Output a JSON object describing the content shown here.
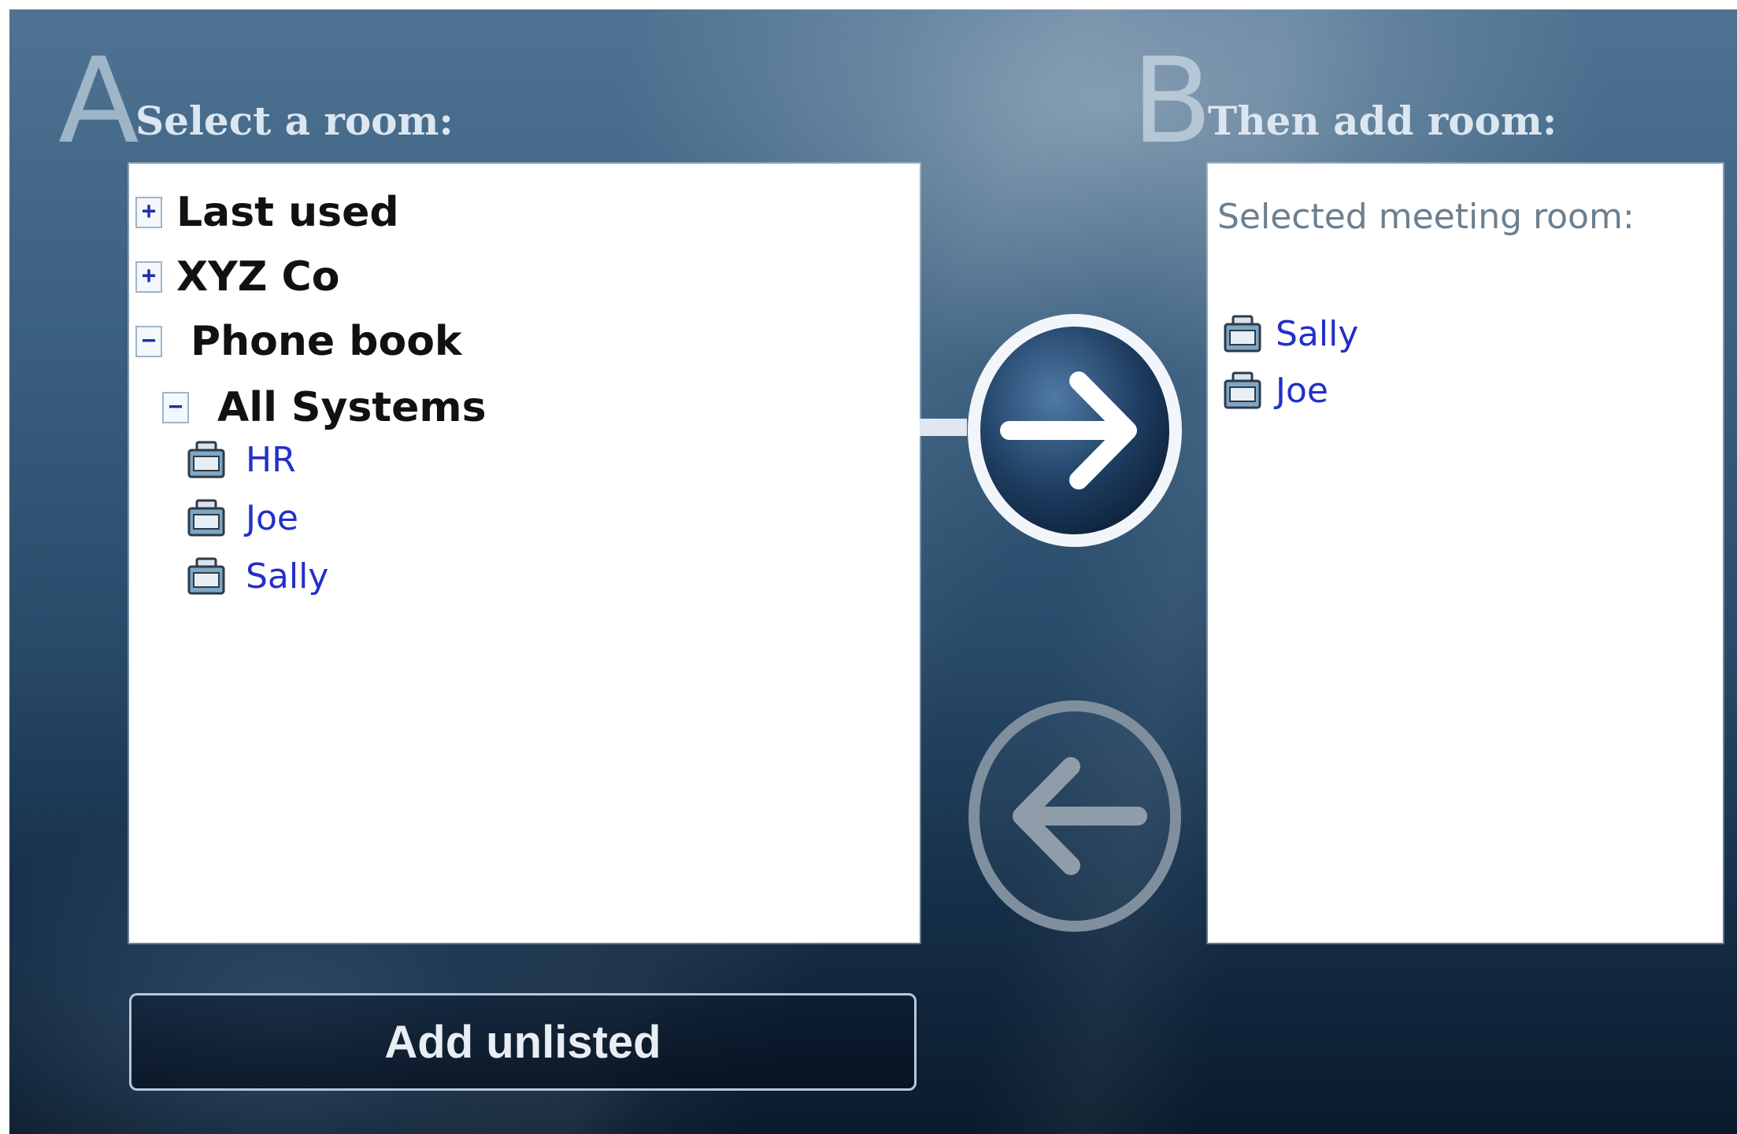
{
  "section_a": {
    "letter": "A",
    "title": "Select a room:"
  },
  "section_b": {
    "letter": "B",
    "title": "Then add room:"
  },
  "tree": {
    "nodes": [
      {
        "toggle": "+",
        "label": "Last used"
      },
      {
        "toggle": "+",
        "label": "XYZ Co"
      },
      {
        "toggle": "−",
        "label": "Phone book"
      },
      {
        "toggle": "−",
        "label": "All Systems"
      }
    ],
    "rooms": [
      "HR",
      "Joe",
      "Sally"
    ]
  },
  "selected": {
    "title": "Selected meeting room:",
    "rooms": [
      "Sally",
      "Joe"
    ]
  },
  "buttons": {
    "add_unlisted": "Add unlisted",
    "add_arrow_icon": "arrow-right-icon",
    "remove_arrow_icon": "arrow-left-icon"
  },
  "colors": {
    "room_link": "#2330c6",
    "toggle_glyph": "#1b2fb0"
  }
}
